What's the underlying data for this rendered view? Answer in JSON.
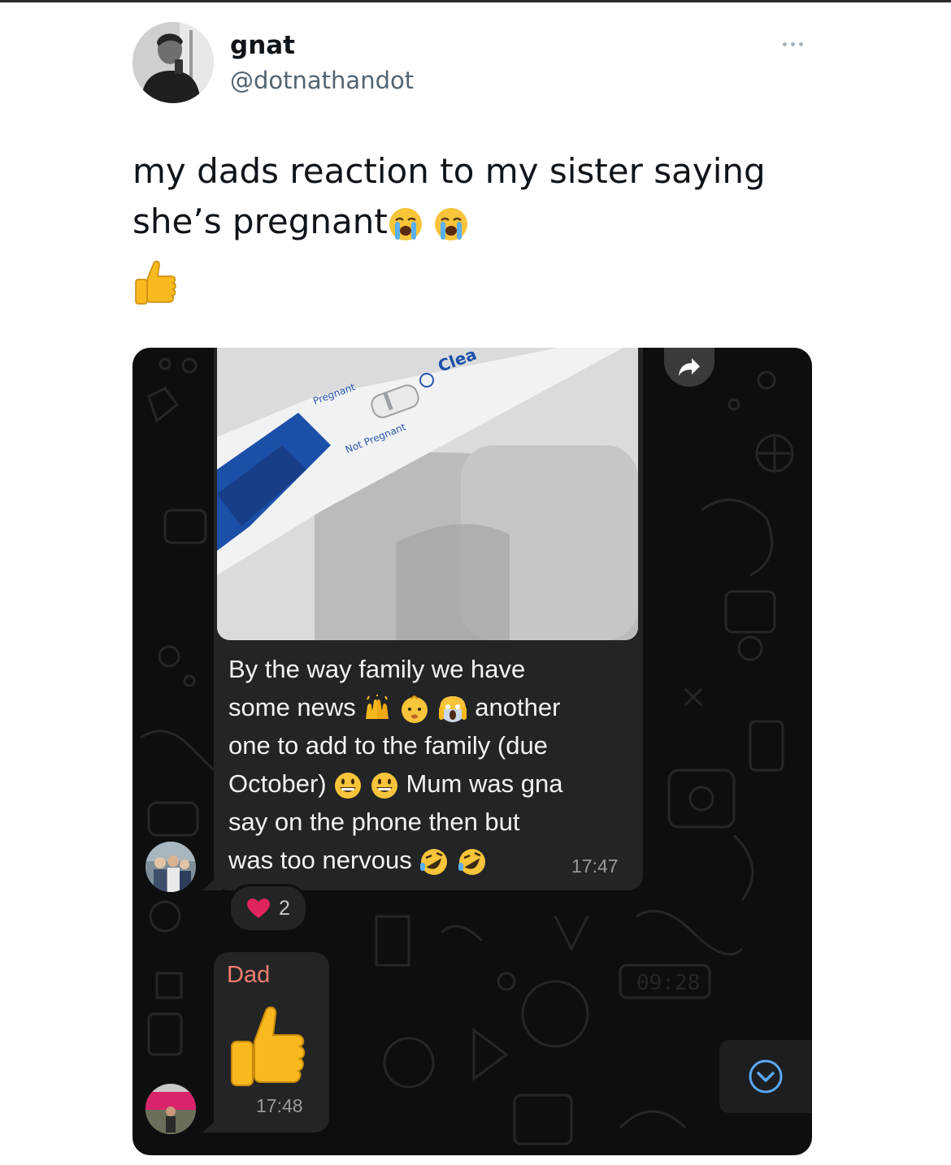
{
  "tweet": {
    "author_name": "gnat",
    "author_handle": "@dotnathandot",
    "text_line1": "my dads reaction to my sister saying",
    "text_line2": "she’s pregnant",
    "emojis": [
      "loudly-crying-face",
      "loudly-crying-face",
      "thumbs-up"
    ]
  },
  "chat": {
    "test_labels": {
      "pregnant": "Pregnant",
      "not_pregnant": "Not Pregnant",
      "brand_partial": "Clea"
    },
    "message_1": {
      "line1": "By the way family we have",
      "line2_a": "some news",
      "line2_b": "another",
      "line3": "one to add to the family (due",
      "line4_a": "October)",
      "line4_b": "Mum was gna",
      "line5": "say on the phone then but",
      "line6": "was too nervous",
      "time": "17:47",
      "reaction_emoji": "red-heart",
      "reaction_count": "2"
    },
    "message_2": {
      "sender": "Dad",
      "content_emoji": "thumbs-up",
      "time": "17:48"
    },
    "wallpaper_clock": "09:28",
    "colors": {
      "bubble": "#232426",
      "background": "#0d0e0f",
      "sender_name": "#f47e6e",
      "heart": "#e0245e"
    }
  }
}
